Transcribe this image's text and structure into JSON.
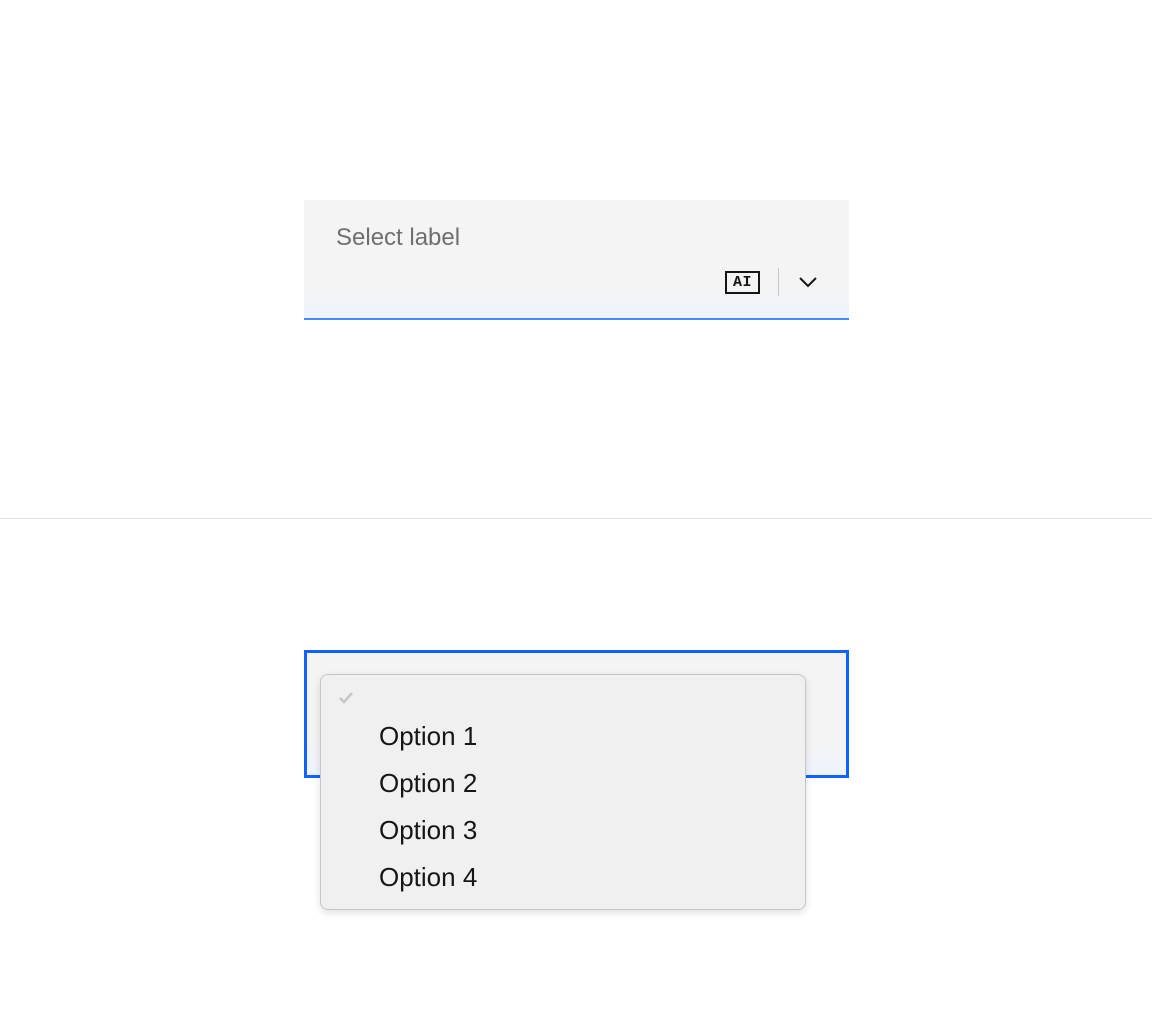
{
  "select_closed": {
    "label": "Select label",
    "ai_badge": "AI"
  },
  "select_open": {
    "options": [
      "Option 1",
      "Option 2",
      "Option 3",
      "Option 4"
    ]
  }
}
